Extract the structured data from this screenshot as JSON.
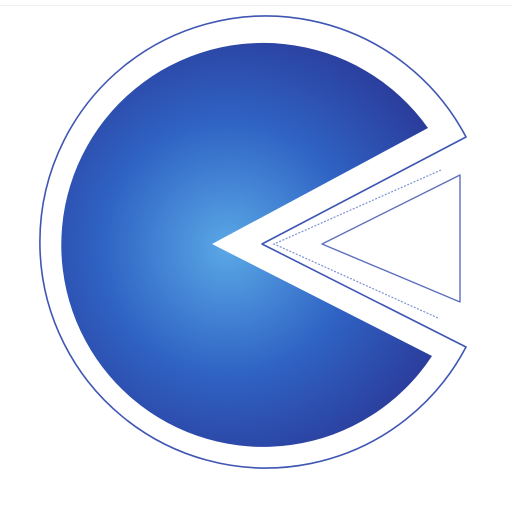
{
  "app_icon": {
    "icon": "pac-chevron-logo-icon",
    "colors": {
      "background": "#ffffff",
      "disc_center": "#5aa8e6",
      "disc_mid": "#2f63c4",
      "disc_edge": "#2b3d9c",
      "outline": "#3f56b3",
      "triangle_fill": "#ffffff",
      "triangle_stroke": "#5c70bf"
    }
  }
}
